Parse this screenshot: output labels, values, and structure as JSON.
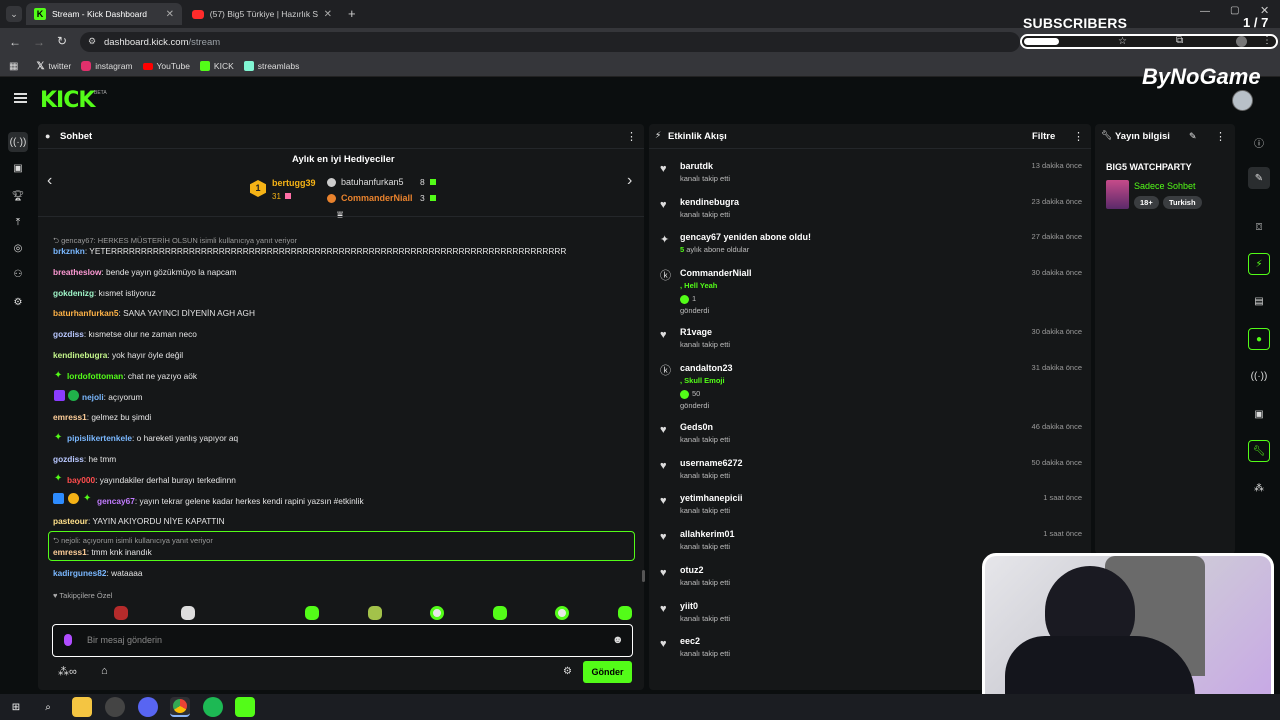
{
  "browser": {
    "tabs": [
      {
        "title": "Stream - Kick Dashboard"
      },
      {
        "title": "(57) Big5 Türkiye | Hazırlık Sezo"
      }
    ],
    "url_domain": "dashboard.kick.com",
    "url_path": "/stream",
    "bookmarks": [
      "twitter",
      "instagram",
      "YouTube",
      "KICK",
      "streamlabs"
    ]
  },
  "overlay": {
    "subscribers_label": "SUBSCRIBERS",
    "subscribers_count": "1 / 7",
    "subscribers_fraction": 0.14,
    "brand": "ByNoGame"
  },
  "kick": {
    "logo": "KICK",
    "beta": "BETA"
  },
  "chat": {
    "title": "Sohbet",
    "gifters_title": "Aylık en iyi Hediyeciler",
    "gifters": [
      {
        "rank": "1",
        "name": "bertugg39",
        "count": "31"
      },
      {
        "name": "batuhanfurkan5",
        "count": "8"
      },
      {
        "name": "CommanderNiall",
        "count": "3"
      }
    ],
    "reply_hint_1": "gencay67: HERKES MÜSTERİH OLSUN isimli kullanıcıya yanıt veriyor",
    "messages": [
      {
        "user": "brkznkn",
        "color": "#7ab8ff",
        "text": "YETERRRRRRRRRRRRRRRRRRRRRRRRRRRRRRRRRRRRRRRRRRRRRRRRRRRRRRRRRRRRRRRRRRRRRRRRRRRR"
      },
      {
        "user": "breatheslow",
        "color": "#ff9ad5",
        "text": "bende yayın gözükmüyo la napcam"
      },
      {
        "user": "gokdenizg",
        "color": "#9ff5c8",
        "text": "kısmet istiyoruz"
      },
      {
        "user": "baturhanfurkan5",
        "color": "#ffb347",
        "text": "SANA YAYINCI DİYENİN AGH AGH"
      },
      {
        "user": "gozdiss",
        "color": "#b9c8ff",
        "text": "kısmetse olur ne zaman neco"
      },
      {
        "user": "kendinebugra",
        "color": "#c4f58a",
        "text": "yok hayır öyle değil"
      },
      {
        "user": "lordofottoman",
        "color": "#53fc18",
        "text": "chat ne yazıyo aök"
      },
      {
        "user": "nejoli",
        "color": "#7ab8ff",
        "text": "açıyorum"
      },
      {
        "user": "emress1",
        "color": "#ffcf9a",
        "text": "gelmez bu şimdi"
      },
      {
        "user": "pipislikertenkele",
        "color": "#7ab8ff",
        "text": "o hareketi yanlış yapıyor aq"
      },
      {
        "user": "gozdiss",
        "color": "#b9c8ff",
        "text": "he tmm"
      },
      {
        "user": "bay000",
        "color": "#ff4d4d",
        "text": "yayındakiler derhal burayı terkedinnn"
      },
      {
        "user": "gencay67",
        "color": "#c27cff",
        "text": "yayın tekrar gelene kadar herkes kendi rapini yazsın #etkinlik"
      },
      {
        "user": "pasteour",
        "color": "#ffe08a",
        "text": "YAYIN AKIYORDU NİYE KAPATTIN"
      }
    ],
    "reply_hint_2": "nejoli: açıyorum isimli kullanıcıya yanıt veriyor",
    "highlight": {
      "user": "emress1",
      "color": "#ffcf9a",
      "text": "tmm knk inandık"
    },
    "last": {
      "user": "kadirgunes82",
      "color": "#7ab8ff",
      "text": "wataaaa"
    },
    "emote_section": "Takipçilere Özel",
    "emotes": [
      "kedi-stop",
      "tabi-canım",
      "kick-blob",
      "kick-face",
      "kick-ball",
      "kick-blob2",
      "kick-ball2",
      "kick-blob3",
      "kick-blob4",
      "kick-mush"
    ],
    "input_placeholder": "Bir mesaj gönderin",
    "send_label": "Gönder"
  },
  "events": {
    "title": "Etkinlik Akışı",
    "filter_label": "Filtre",
    "items": [
      {
        "icon": "heart-icon",
        "name": "barutdk",
        "sub": "kanalı takip etti",
        "time": "13 dakika önce"
      },
      {
        "icon": "heart-icon",
        "name": "kendinebugra",
        "sub": "kanalı takip etti",
        "time": "23 dakika önce"
      },
      {
        "icon": "sparkle-icon",
        "name": "gencay67 yeniden abone oldu!",
        "sub_prefix": "5",
        "sub": "aylık abone oldular",
        "time": "27 dakika önce"
      },
      {
        "icon": "kick-coin-icon",
        "name": "CommanderNiall",
        "reward": ", Hell Yeah",
        "amount": "1",
        "sub": "gönderdi",
        "time": "30 dakika önce"
      },
      {
        "icon": "heart-icon",
        "name": "R1vage",
        "sub": "kanalı takip etti",
        "time": "30 dakika önce"
      },
      {
        "icon": "kick-coin-icon",
        "name": "candalton23",
        "reward": ", Skull Emoji",
        "amount": "50",
        "sub": "gönderdi",
        "time": "31 dakika önce"
      },
      {
        "icon": "heart-icon",
        "name": "Geds0n",
        "sub": "kanalı takip etti",
        "time": "46 dakika önce"
      },
      {
        "icon": "heart-icon",
        "name": "username6272",
        "sub": "kanalı takip etti",
        "time": "50 dakika önce"
      },
      {
        "icon": "heart-icon",
        "name": "yetimhanepicii",
        "sub": "kanalı takip etti",
        "time": "1 saat önce"
      },
      {
        "icon": "heart-icon",
        "name": "allahkerim01",
        "sub": "kanalı takip etti",
        "time": "1 saat önce"
      },
      {
        "icon": "heart-icon",
        "name": "otuz2",
        "sub": "kanalı takip etti",
        "time": ""
      },
      {
        "icon": "heart-icon",
        "name": "yiit0",
        "sub": "kanalı takip etti",
        "time": ""
      },
      {
        "icon": "heart-icon",
        "name": "eec2",
        "sub": "kanalı takip etti",
        "time": ""
      }
    ]
  },
  "stream_info": {
    "title": "Yayın bilgisi",
    "stream_title": "BIG5 WATCHPARTY",
    "category": "Sadece Sohbet",
    "tags": [
      "18+",
      "Turkish"
    ]
  },
  "colors": {
    "accent": "#53fc18",
    "panel": "#151718",
    "bg": "#0b0e0f"
  }
}
